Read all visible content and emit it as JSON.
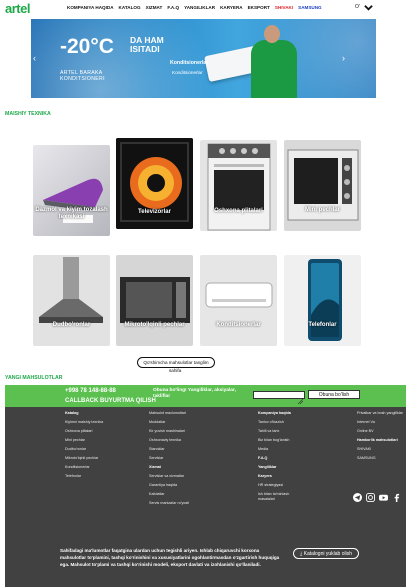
{
  "header": {
    "logo": "artel",
    "nav": [
      "KOMPANIYA HAQIDA",
      "KATALOG",
      "XIZMAT",
      "F.A.Q",
      "YANGILIKLAR",
      "KARYERA",
      "EKSPORT",
      "SHIVAKI",
      "SAMSUNG"
    ],
    "lang": "O'"
  },
  "banner": {
    "headline": "-20°C",
    "headline_sub_1": "DA HAM",
    "headline_sub_2": "ISITADI",
    "brand_line_1": "ARTEL BARAKA",
    "brand_line_2": "KONDITSIONERI",
    "label_1": "Konditsionerlar",
    "label_2": "Konditsionerlar",
    "colors": {
      "brand_green": "#1ea84a",
      "banner_blue": "#2a8ccc"
    }
  },
  "sections": {
    "maishiy": "MAISHIY TEXNIKA",
    "yangi": "YANGI MAHSULOTLAR"
  },
  "products": [
    {
      "label": "Dazmol va kiyim tozalash texnikasi"
    },
    {
      "label": "Televizorlar"
    },
    {
      "label": "Oshxona plitalari"
    },
    {
      "label": "Mini pechlar"
    },
    {
      "label": "Dudbo'ronlar"
    },
    {
      "label": "Mikroto'lqinli pechlar"
    },
    {
      "label": "Konditsionerlar"
    },
    {
      "label": "Telefonlar"
    }
  ],
  "more_button": {
    "line1": "Qo'shimcha mahsulotlar tanglim",
    "line2": "sahifa"
  },
  "callback": {
    "phone": "+998 78 148-88-88",
    "cta": "CALLBACK BUYURTMA QILISH",
    "subscribe_text": "Obuna bo'ling! Yangiliklar, aksiyalar, takliflar",
    "email_placeholder": "",
    "subscribe_button": "Obuna bo'lish"
  },
  "footer": {
    "col1": {
      "heading": "Katalog",
      "items": [
        "Kiyimni maishiy texnika",
        "Oshxona plitalari",
        "Mini pechlar",
        "Dudbo'ronlar",
        "Mikroto'lqinli pechlar",
        "Konditsionerlar",
        "Telefonlar"
      ]
    },
    "col2": {
      "items": [
        "Mahsulot maxlumotlari",
        "Muddatlar",
        "Kir yuvish mashinalari",
        "Oshxonaviy texnika",
        "Stanoklar",
        "Servislar"
      ],
      "heading2": "Xizmat",
      "items2": [
        "Servislar va xizmatlar",
        "Garantiya haqida",
        "Kafolatlar",
        "Servis markazlar ro'yxati"
      ]
    },
    "col3": {
      "heading": "Kompaniya haqida",
      "items": [
        "Tanlov o'tkazish",
        "Tahlil va tarix",
        "Biz bilan bog'lanish",
        "Media"
      ],
      "faq": "F.A.Q",
      "news": "Yangiliklar",
      "career": "Karyera",
      "career_items": [
        "HR strategiyasi",
        "Ish bilan ta'minlash",
        "masalalari"
      ]
    },
    "col4": {
      "items": [
        "Privatkar va bosh yangiliklar",
        "Internet Va",
        "Online BV"
      ],
      "heading": "Hamkorlik mahsulotlari",
      "partners": [
        "SHIVAKI",
        "SAMSUNG"
      ]
    },
    "social_icons": [
      "telegram-icon",
      "instagram-icon",
      "youtube-icon",
      "facebook-icon"
    ],
    "note": "Sahifadagi ma'lumotlar faqatgina ulardan uchun tegishli ariyen. Ishlab chiqaruvchi korxona mahsulotlar to'plamini, tashqi ko'rinishini va xususiyatlarini ogohlantirmasdan o'zgartirish huquqiga ega. Mahsulot to'plami va tashqi ko'rinishi modeli, eksport davlati va izohlanishi qo'llaniladi.",
    "download_button": "Katalogni yuklab olish"
  }
}
